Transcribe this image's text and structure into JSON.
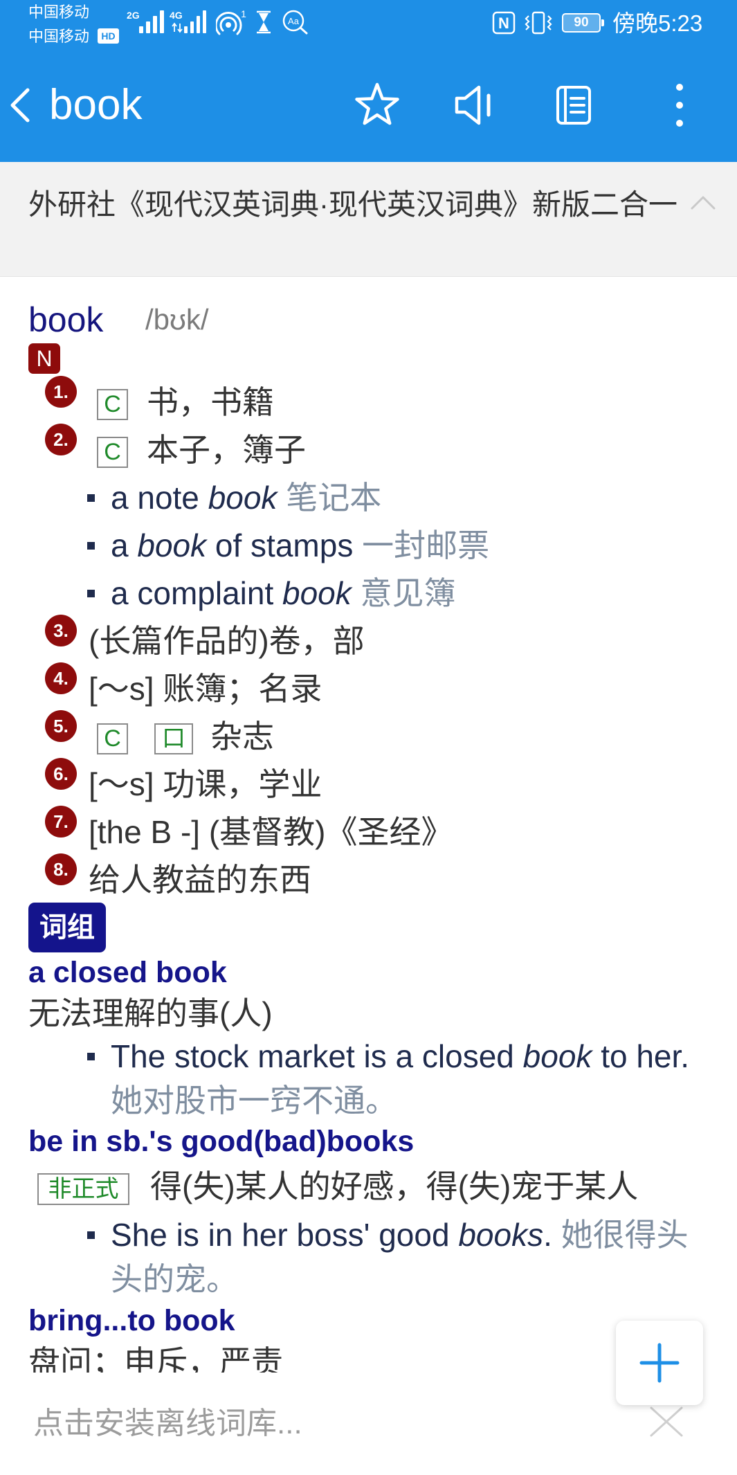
{
  "colors": {
    "primary": "#1e8fe6",
    "headword": "#15157e",
    "badge_red": "#8e0b0b",
    "badge_navy": "#14148c",
    "tag_green": "#1f8a2a",
    "example_en": "#1f2b4d",
    "example_zh": "#7f8ea0"
  },
  "status_bar": {
    "carrier_1": "中国移动",
    "carrier_2": "中国移动",
    "hd_badge": "HD",
    "network_1": "2G",
    "network_2": "4G",
    "hotspot_count": "1",
    "text_badge": "Aa",
    "nfc_badge": "N",
    "battery_level": "90",
    "time": "傍晚5:23",
    "icons": [
      "signal-bars-icon",
      "signal-bars-icon",
      "hotspot-icon",
      "hourglass-icon",
      "text-search-icon",
      "nfc-icon",
      "vibrate-icon",
      "battery-icon"
    ]
  },
  "header": {
    "title": "book",
    "back_icon": "chevron-left-icon",
    "actions": [
      {
        "icon": "star-icon"
      },
      {
        "icon": "speaker-icon"
      },
      {
        "icon": "notebook-icon"
      },
      {
        "icon": "more-vertical-icon"
      }
    ]
  },
  "source": {
    "title": "外研社《现代汉英词典·现代英汉词典》新版二合一",
    "toggle_icon": "chevron-up-icon"
  },
  "entry": {
    "headword": "book",
    "phonetic": "/bʊk/",
    "pos": "N",
    "senses": [
      {
        "num": "1.",
        "tags": [
          "C"
        ],
        "def": "书，书籍"
      },
      {
        "num": "2.",
        "tags": [
          "C"
        ],
        "def": "本子，簿子",
        "examples": [
          {
            "pre": "a note ",
            "kw": "book",
            "post": "",
            "zh": "笔记本"
          },
          {
            "pre": "a ",
            "kw": "book",
            "post": " of stamps",
            "zh": "一封邮票"
          },
          {
            "pre": "a complaint ",
            "kw": "book",
            "post": "",
            "zh": "意见簿"
          }
        ]
      },
      {
        "num": "3.",
        "def": "(长篇作品的)卷，部"
      },
      {
        "num": "4.",
        "def": "[～s] 账簿；名录"
      },
      {
        "num": "5.",
        "tags": [
          "C",
          "口"
        ],
        "def": "杂志"
      },
      {
        "num": "6.",
        "def": "[～s] 功课，学业"
      },
      {
        "num": "7.",
        "def": "[the B -] (基督教)《圣经》"
      },
      {
        "num": "8.",
        "def": "给人教益的东西"
      }
    ]
  },
  "phrases_label": "词组",
  "phrases": [
    {
      "head": "a closed book",
      "def": "无法理解的事(人)",
      "examples": [
        {
          "pre": "The stock market is a closed ",
          "kw": "book",
          "post": " to her.",
          "zh": "她对股市一窍不通。"
        }
      ]
    },
    {
      "head": "be in sb.'s good(bad)books",
      "tag": "非正式",
      "def": "得(失)某人的好感，得(失)宠于某人",
      "examples": [
        {
          "pre": "She is in her boss' good ",
          "kw": "books",
          "post": ".",
          "zh": "她很得头头的宠。"
        }
      ]
    },
    {
      "head": "bring...to book",
      "def": "盘问；申斥，严责"
    }
  ],
  "bottom": {
    "install_text": "点击安装离线词库...",
    "add_icon": "plus-icon",
    "close_icon": "close-icon"
  }
}
